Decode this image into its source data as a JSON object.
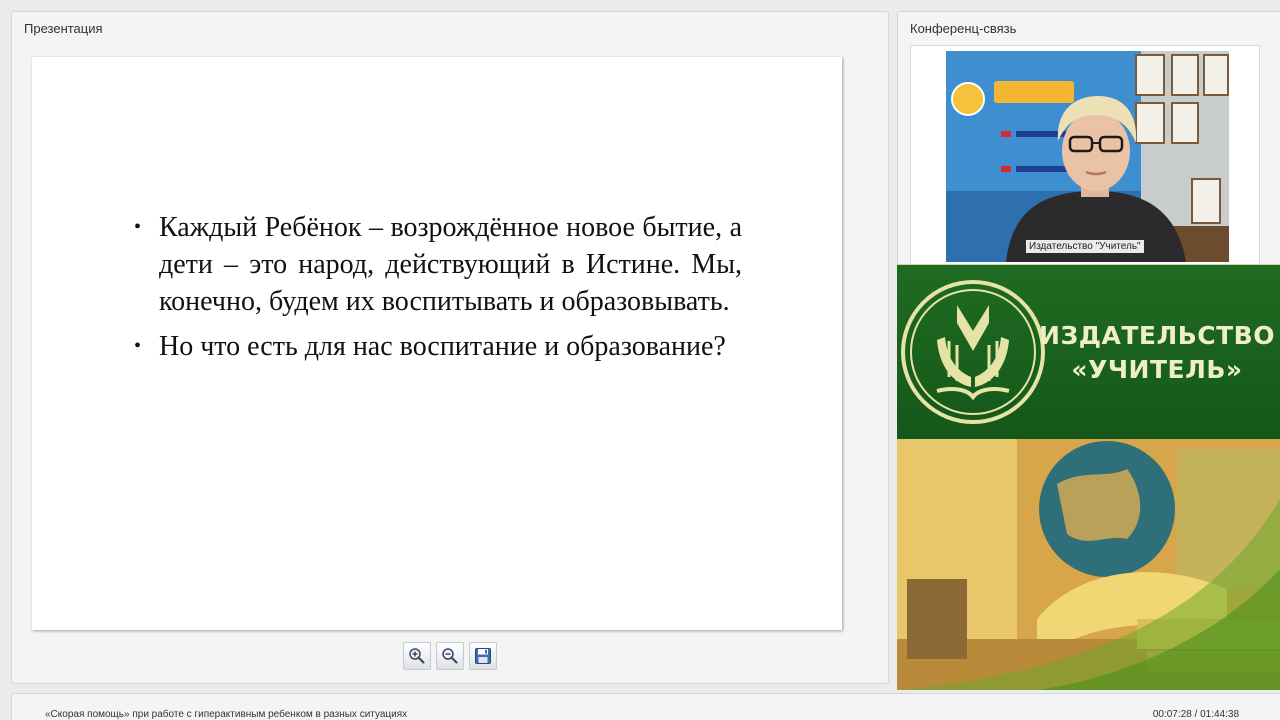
{
  "presentation": {
    "panel_title": "Презентация",
    "slide": {
      "bullets": [
        "Каждый Ребёнок – возрождённое новое бытие, а дети – это народ, действующий в Истине. Мы, конечно, будем их воспитывать и образовывать.",
        "Но что есть для нас воспитание и образование?"
      ],
      "bullet_symbol": "•"
    },
    "toolbar": {
      "zoom_in_icon": "zoom-in-icon",
      "zoom_out_icon": "zoom-out-icon",
      "save_icon": "save-icon"
    }
  },
  "conference": {
    "panel_title": "Конференц-связь",
    "participant_name": "Издательство \"Учитель\""
  },
  "banner": {
    "brand_line1": "ИЗДАТЕЛЬСТВО",
    "brand_line2": "«УЧИТЕЛЬ»",
    "colors": {
      "green": "#1a621d",
      "gold": "#e6e3a6"
    }
  },
  "status": {
    "webinar_title": "«Скорая помощь» при работе с гиперактивным ребенком в разных ситуациях",
    "time": "00:07:28 / 01:44:38"
  }
}
